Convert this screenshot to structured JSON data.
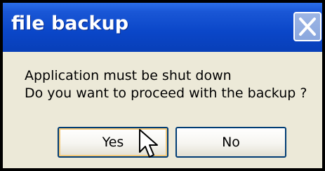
{
  "window": {
    "title": "file backup",
    "close_icon": "close-icon"
  },
  "message": {
    "line1": "Application must be shut down",
    "line2": "Do you want to proceed with the backup ?"
  },
  "buttons": {
    "yes_label": "Yes",
    "no_label": "No"
  },
  "colors": {
    "titlebar": "#0a46c8",
    "client_bg": "#ece9d8",
    "button_border": "#003c74",
    "default_button_highlight": "#f4c97a"
  },
  "cursor": {
    "icon": "mouse-pointer-icon"
  }
}
